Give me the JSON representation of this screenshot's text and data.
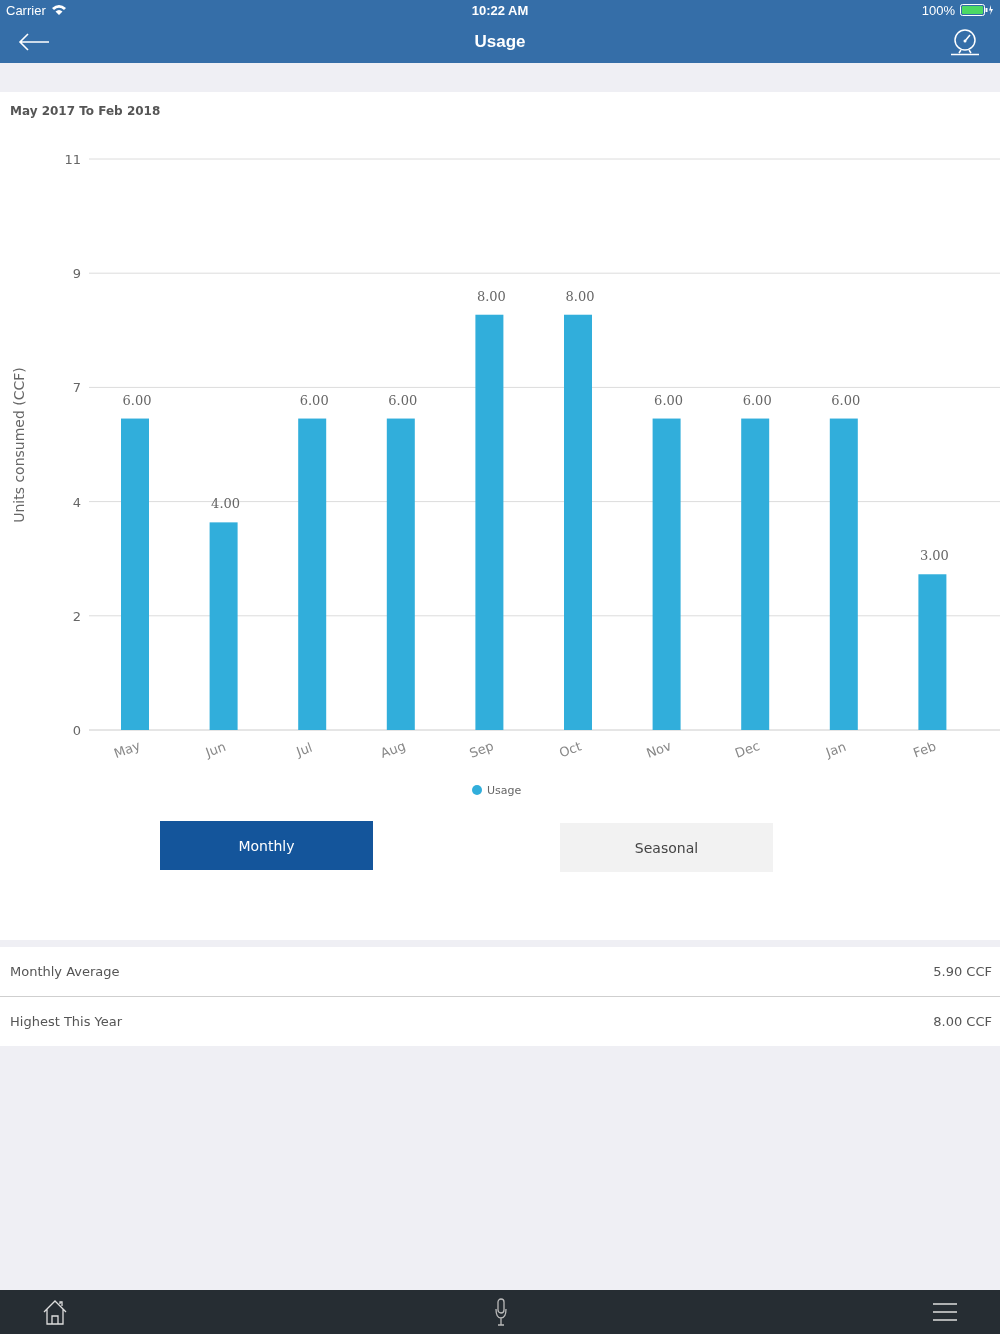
{
  "status_bar": {
    "carrier": "Carrier",
    "time": "10:22 AM",
    "battery": "100%"
  },
  "header": {
    "title": "Usage"
  },
  "chart_section": {
    "period": "May 2017 To Feb 2018",
    "chart_data": {
      "type": "bar",
      "ylabel": "Units consumed (CCF)",
      "categories": [
        "May",
        "Jun",
        "Jul",
        "Aug",
        "Sep",
        "Oct",
        "Nov",
        "Dec",
        "Jan",
        "Feb"
      ],
      "series": [
        {
          "name": "Usage",
          "color": "#31aedb",
          "values": [
            6,
            4,
            6,
            6,
            8,
            8,
            6,
            6,
            6,
            3
          ]
        }
      ],
      "ylim": [
        0,
        11
      ],
      "yticks": [
        {
          "value": 0,
          "label": "0"
        },
        {
          "value": 2.2,
          "label": "2"
        },
        {
          "value": 4.4,
          "label": "4"
        },
        {
          "value": 6.6,
          "label": "7"
        },
        {
          "value": 8.8,
          "label": "9"
        },
        {
          "value": 11,
          "label": "11"
        }
      ],
      "grid": true,
      "value_labels": [
        "6.00",
        "4.00",
        "6.00",
        "6.00",
        "8.00",
        "8.00",
        "6.00",
        "6.00",
        "6.00",
        "3.00"
      ]
    }
  },
  "tabs": [
    {
      "label": "Monthly",
      "selected": true
    },
    {
      "label": "Seasonal",
      "selected": false
    }
  ],
  "stats": [
    {
      "label": "Monthly Average",
      "value": "5.90 CCF"
    },
    {
      "label": "Highest This Year",
      "value": "8.00 CCF"
    }
  ]
}
